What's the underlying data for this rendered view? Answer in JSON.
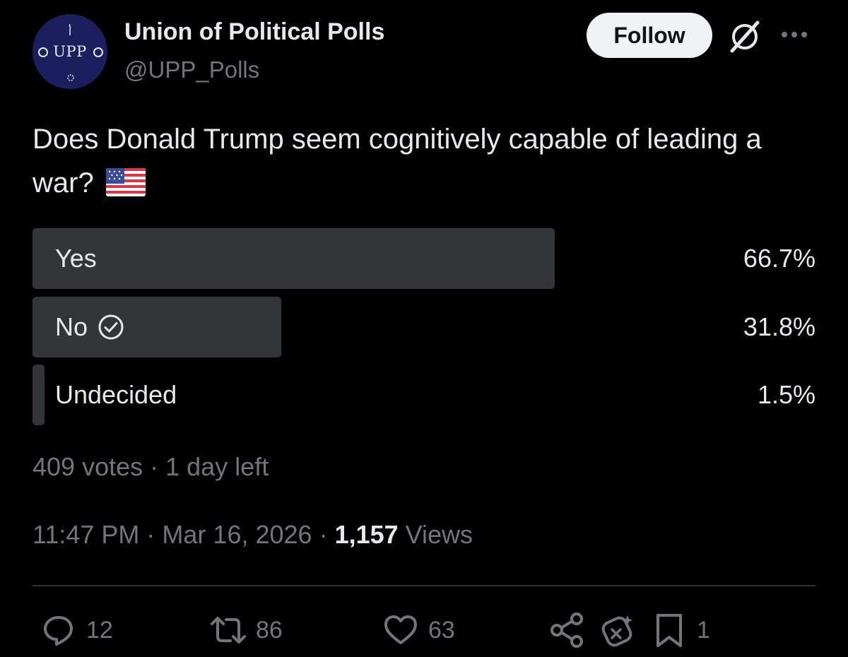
{
  "account": {
    "display_name": "Union of Political Polls",
    "handle": "@UPP_Polls",
    "avatar_text": "UPP"
  },
  "follow_label": "Follow",
  "question": "Does Donald Trump seem cognitively capable of leading a war?",
  "poll": {
    "options": [
      {
        "label": "Yes",
        "percent": "66.7%",
        "share": 0.667
      },
      {
        "label": "No",
        "percent": "31.8%",
        "share": 0.318,
        "voted": true
      },
      {
        "label": "Undecided",
        "percent": "1.5%",
        "share": 0.015
      }
    ],
    "votes": "409 votes",
    "time_left": "1 day left"
  },
  "post_meta": {
    "time": "11:47 PM",
    "date": "Mar 16, 2026",
    "views_count": "1,157",
    "views_label": "Views"
  },
  "actions": {
    "replies": "12",
    "reposts": "86",
    "likes": "63",
    "bookmarks": "1"
  },
  "colors": {
    "background": "#000000",
    "text": "#e7e9ea",
    "muted": "#71767b",
    "bar": "#333639",
    "avatar": "#1b1f5e"
  },
  "icons": [
    "grok-icon",
    "more-icon",
    "flag-us-icon",
    "check-circle-icon",
    "reply-icon",
    "repost-icon",
    "like-icon",
    "share-icon",
    "grok-analyze-icon",
    "bookmark-icon"
  ]
}
